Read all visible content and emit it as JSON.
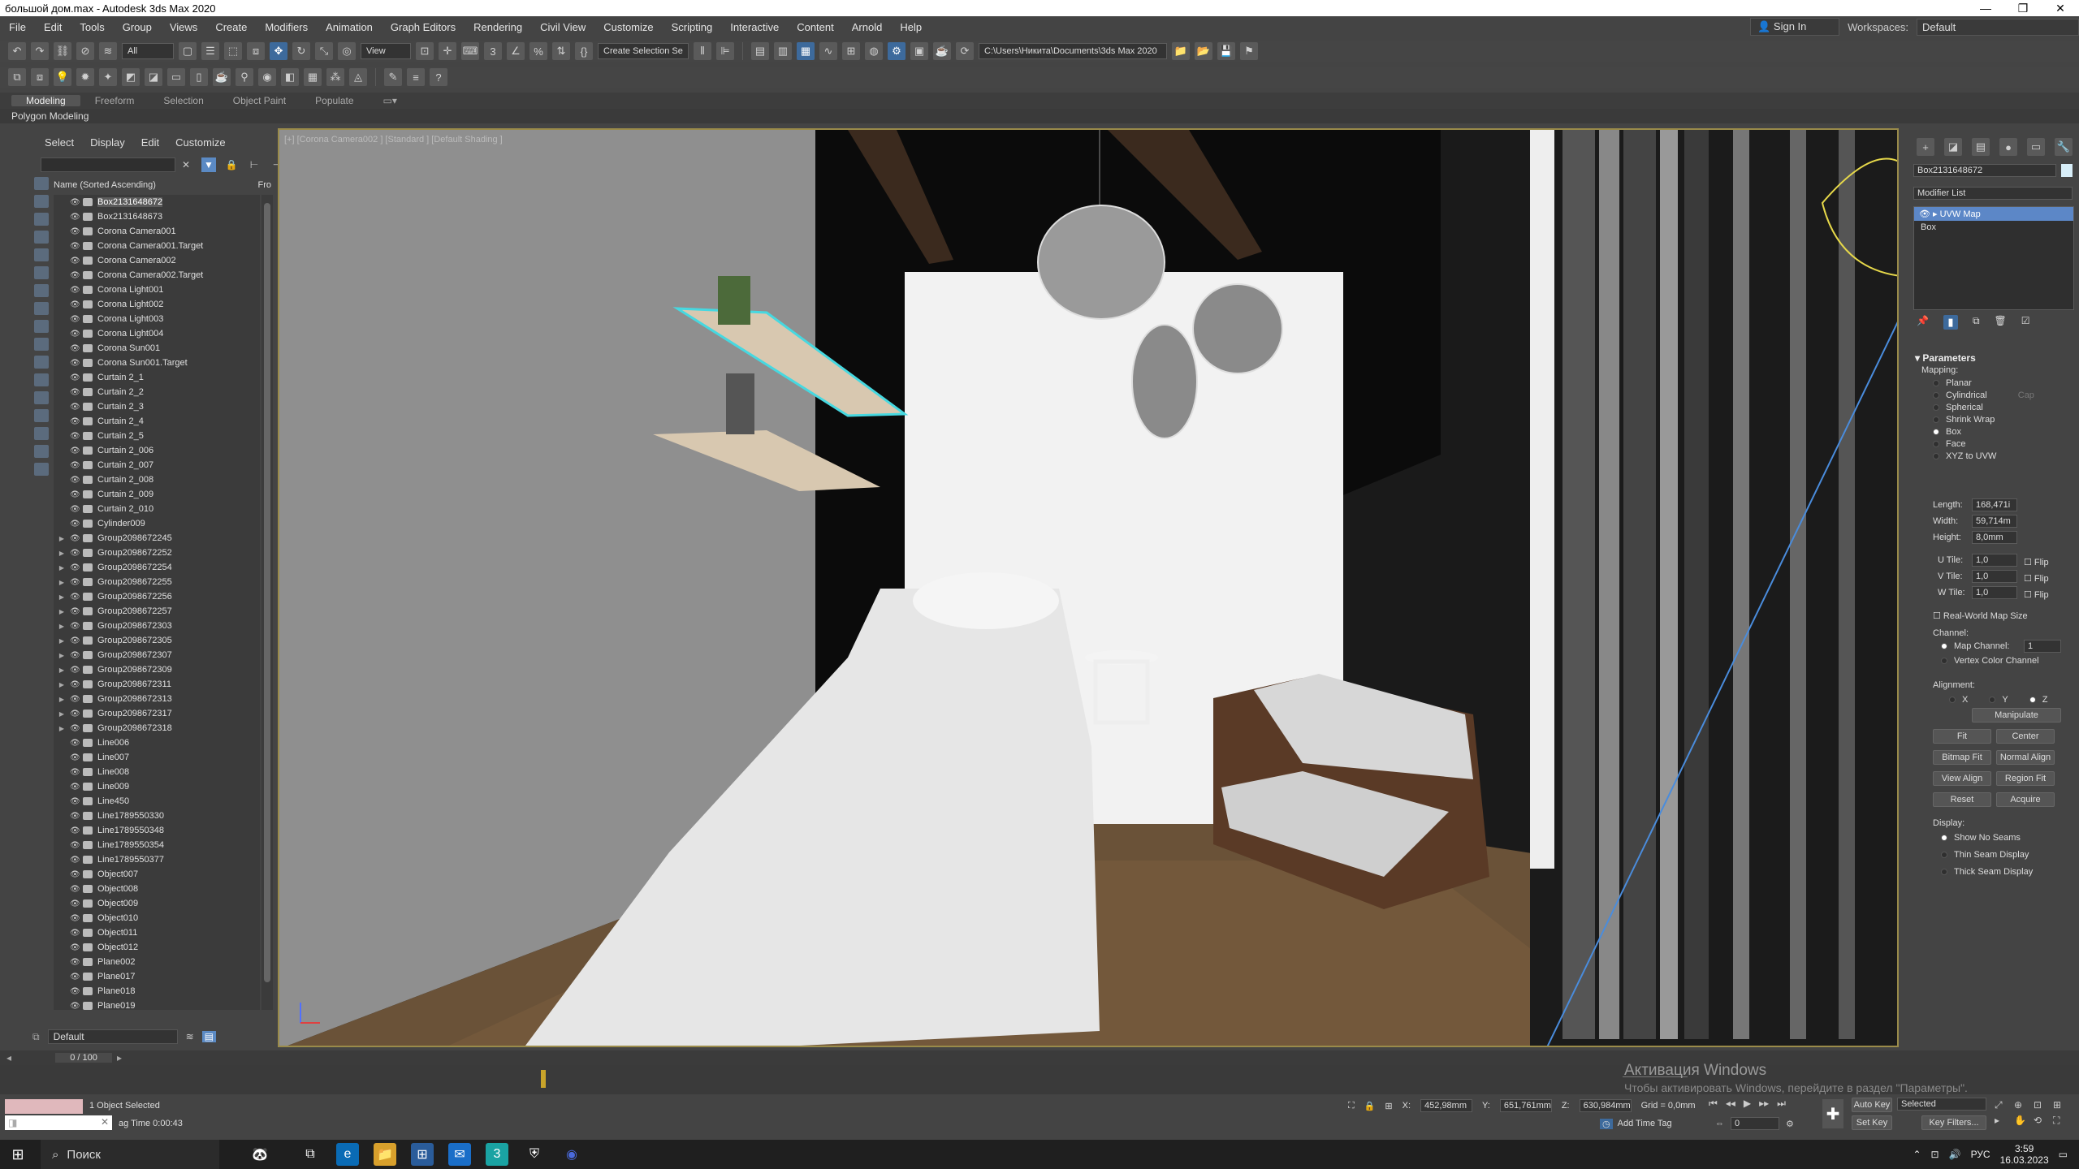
{
  "window": {
    "title": "большой дом.max - Autodesk 3ds Max 2020",
    "min": "—",
    "max": "❐",
    "close": "✕"
  },
  "menu": [
    "File",
    "Edit",
    "Tools",
    "Group",
    "Views",
    "Create",
    "Modifiers",
    "Animation",
    "Graph Editors",
    "Rendering",
    "Civil View",
    "Customize",
    "Scripting",
    "Interactive",
    "Content",
    "Arnold",
    "Help"
  ],
  "account": {
    "signin": "Sign In",
    "workspaces_label": "Workspaces:",
    "workspace": "Default"
  },
  "toolbar": {
    "filter": "All",
    "refcoord": "View",
    "selection_set": "Create Selection Se",
    "project_path": "C:\\Users\\Никита\\Documents\\3ds Max 2020"
  },
  "ribbon": {
    "tabs": [
      "Modeling",
      "Freeform",
      "Selection",
      "Object Paint",
      "Populate"
    ],
    "active": "Modeling",
    "sub": "Polygon Modeling"
  },
  "explorer": {
    "menu": [
      "Select",
      "Display",
      "Edit",
      "Customize"
    ],
    "column_header": "Name (Sorted Ascending)",
    "column_header2": "Fro",
    "items": [
      {
        "name": "Box2131648672",
        "group": false,
        "selected": true
      },
      {
        "name": "Box2131648673",
        "group": false
      },
      {
        "name": "Corona Camera001",
        "group": false
      },
      {
        "name": "Corona Camera001.Target",
        "group": false
      },
      {
        "name": "Corona Camera002",
        "group": false
      },
      {
        "name": "Corona Camera002.Target",
        "group": false
      },
      {
        "name": "Corona Light001",
        "group": false
      },
      {
        "name": "Corona Light002",
        "group": false
      },
      {
        "name": "Corona Light003",
        "group": false
      },
      {
        "name": "Corona Light004",
        "group": false
      },
      {
        "name": "Corona Sun001",
        "group": false
      },
      {
        "name": "Corona Sun001.Target",
        "group": false
      },
      {
        "name": "Curtain 2_1",
        "group": false
      },
      {
        "name": "Curtain 2_2",
        "group": false
      },
      {
        "name": "Curtain 2_3",
        "group": false
      },
      {
        "name": "Curtain 2_4",
        "group": false
      },
      {
        "name": "Curtain 2_5",
        "group": false
      },
      {
        "name": "Curtain 2_006",
        "group": false
      },
      {
        "name": "Curtain 2_007",
        "group": false
      },
      {
        "name": "Curtain 2_008",
        "group": false
      },
      {
        "name": "Curtain 2_009",
        "group": false
      },
      {
        "name": "Curtain 2_010",
        "group": false
      },
      {
        "name": "Cylinder009",
        "group": false
      },
      {
        "name": "Group2098672245",
        "group": true
      },
      {
        "name": "Group2098672252",
        "group": true
      },
      {
        "name": "Group2098672254",
        "group": true
      },
      {
        "name": "Group2098672255",
        "group": true
      },
      {
        "name": "Group2098672256",
        "group": true
      },
      {
        "name": "Group2098672257",
        "group": true
      },
      {
        "name": "Group2098672303",
        "group": true
      },
      {
        "name": "Group2098672305",
        "group": true
      },
      {
        "name": "Group2098672307",
        "group": true
      },
      {
        "name": "Group2098672309",
        "group": true
      },
      {
        "name": "Group2098672311",
        "group": true
      },
      {
        "name": "Group2098672313",
        "group": true
      },
      {
        "name": "Group2098672317",
        "group": true
      },
      {
        "name": "Group2098672318",
        "group": true
      },
      {
        "name": "Line006",
        "group": false
      },
      {
        "name": "Line007",
        "group": false
      },
      {
        "name": "Line008",
        "group": false
      },
      {
        "name": "Line009",
        "group": false
      },
      {
        "name": "Line450",
        "group": false
      },
      {
        "name": "Line1789550330",
        "group": false
      },
      {
        "name": "Line1789550348",
        "group": false
      },
      {
        "name": "Line1789550354",
        "group": false
      },
      {
        "name": "Line1789550377",
        "group": false
      },
      {
        "name": "Object007",
        "group": false
      },
      {
        "name": "Object008",
        "group": false
      },
      {
        "name": "Object009",
        "group": false
      },
      {
        "name": "Object010",
        "group": false
      },
      {
        "name": "Object011",
        "group": false
      },
      {
        "name": "Object012",
        "group": false
      },
      {
        "name": "Plane002",
        "group": false
      },
      {
        "name": "Plane017",
        "group": false
      },
      {
        "name": "Plane018",
        "group": false
      },
      {
        "name": "Plane019",
        "group": false
      }
    ],
    "layer": "Default"
  },
  "viewport": {
    "label": "[+] [Corona Camera002 ] [Standard ] [Default Shading ]"
  },
  "command_panel": {
    "object_name": "Box2131648672",
    "modifier_list": "Modifier List",
    "stack": [
      "UVW Map",
      "Box"
    ],
    "rollout": "Parameters",
    "mapping_label": "Mapping:",
    "mapping": [
      "Planar",
      "Cylindrical",
      "Spherical",
      "Shrink Wrap",
      "Box",
      "Face",
      "XYZ to UVW"
    ],
    "mapping_selected": "Box",
    "cap": "Cap",
    "length_label": "Length:",
    "length": "168,471i",
    "width_label": "Width:",
    "width": "59,714m",
    "height_label": "Height:",
    "height": "8,0mm",
    "utile_label": "U Tile:",
    "utile": "1,0",
    "vtile_label": "V Tile:",
    "vtile": "1,0",
    "wtile_label": "W Tile:",
    "wtile": "1,0",
    "flip": "Flip",
    "realworld": "Real-World Map Size",
    "channel_label": "Channel:",
    "map_channel": "Map Channel:",
    "map_channel_val": "1",
    "vertex_color": "Vertex Color Channel",
    "alignment_label": "Alignment:",
    "axes": [
      "X",
      "Y",
      "Z"
    ],
    "manipulate": "Manipulate",
    "fit": "Fit",
    "center": "Center",
    "bitmap_fit": "Bitmap Fit",
    "normal_align": "Normal Align",
    "view_align": "View Align",
    "region_fit": "Region Fit",
    "reset": "Reset",
    "acquire": "Acquire",
    "display_label": "Display:",
    "display": [
      "Show No Seams",
      "Thin Seam Display",
      "Thick Seam Display"
    ]
  },
  "timeline": {
    "frame": "0 / 100"
  },
  "status": {
    "selected": "1 Object Selected",
    "time": "ag Time 0:00:43",
    "x_label": "X:",
    "x": "452,98mm",
    "y_label": "Y:",
    "y": "651,761mm",
    "z_label": "Z:",
    "z": "630,984mm",
    "grid": "Grid = 0,0mm",
    "add_time_tag": "Add Time Tag",
    "auto_key": "Auto Key",
    "set_key": "Set Key",
    "selected_drop": "Selected",
    "key_filters": "Key Filters...",
    "frame_field": "0",
    "watermark1": "Активация Windows",
    "watermark2": "Чтобы активировать Windows, перейдите в раздел \"Параметры\"."
  },
  "taskbar": {
    "search": "Поиск",
    "lang": "РУС",
    "time": "3:59",
    "date": "16.03.2023"
  }
}
